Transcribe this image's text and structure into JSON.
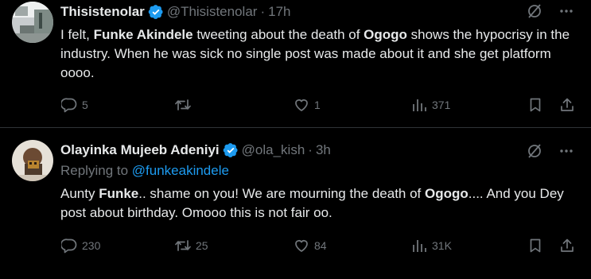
{
  "tweets": [
    {
      "display_name": "Thisistenolar",
      "handle": "@Thisistenolar",
      "separator": "·",
      "time": "17h",
      "verified": true,
      "text_segments": [
        {
          "text": "I felt, ",
          "bold": false
        },
        {
          "text": "Funke Akindele",
          "bold": true
        },
        {
          "text": " tweeting about the death of ",
          "bold": false
        },
        {
          "text": "Ogogo",
          "bold": true
        },
        {
          "text": " shows the hypocrisy in the industry. When he was sick no single post was made about it and she get platform oooo.",
          "bold": false
        }
      ],
      "actions": {
        "replies": "5",
        "retweets": "",
        "likes": "1",
        "views": "371"
      }
    },
    {
      "display_name": "Olayinka Mujeeb Adeniyi",
      "handle": "@ola_kish",
      "separator": "·",
      "time": "3h",
      "verified": true,
      "replying_to_label": "Replying to ",
      "replying_to_handle": "@funkeakindele",
      "text_segments": [
        {
          "text": "Aunty ",
          "bold": false
        },
        {
          "text": "Funke",
          "bold": true
        },
        {
          "text": ".. shame on you! We are mourning the death of ",
          "bold": false
        },
        {
          "text": "Ogogo",
          "bold": true
        },
        {
          "text": ".... And you Dey post about birthday. Omooo this is not fair oo.",
          "bold": false
        }
      ],
      "actions": {
        "replies": "230",
        "retweets": "25",
        "likes": "84",
        "views": "31K"
      }
    }
  ],
  "colors": {
    "background": "#000000",
    "primary_text": "#e7e9ea",
    "secondary_text": "#71767b",
    "accent": "#1d9bf0",
    "divider": "#2f3336"
  },
  "icons": {
    "reply": "speech-bubble-icon",
    "retweet": "retweet-arrows-icon",
    "like": "heart-icon",
    "views": "bar-chart-icon",
    "bookmark": "bookmark-icon",
    "share": "share-upload-icon",
    "grok": "grok-slash-circle-icon",
    "more": "more-dots-icon",
    "verified": "verified-badge-icon"
  }
}
